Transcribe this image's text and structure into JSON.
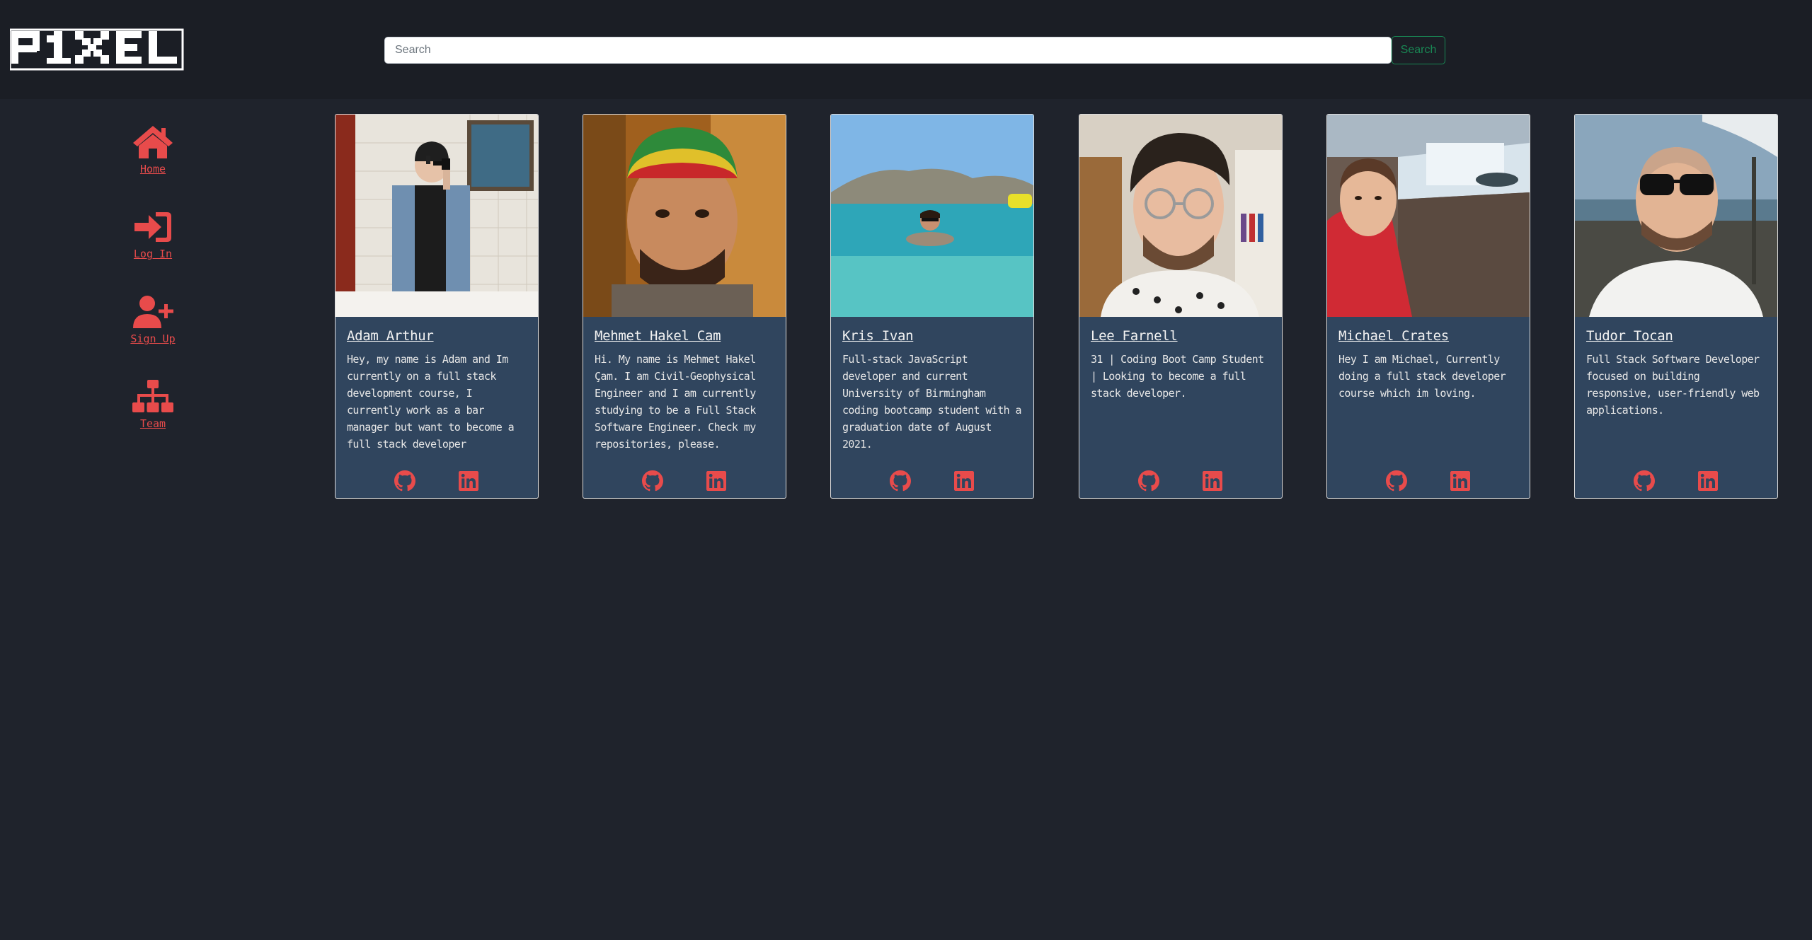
{
  "header": {
    "logo_text": "P1XEL",
    "search": {
      "placeholder": "Search",
      "value": "",
      "button_label": "Search"
    }
  },
  "sidebar": {
    "items": [
      {
        "label": "Home",
        "icon": "home-icon"
      },
      {
        "label": "Log In",
        "icon": "sign-in-icon"
      },
      {
        "label": "Sign Up",
        "icon": "user-plus-icon"
      },
      {
        "label": "Team",
        "icon": "sitemap-icon"
      }
    ]
  },
  "team": [
    {
      "name": "Adam Arthur",
      "bio": "Hey, my name is Adam and Im currently on a full stack development course, I currently work as a bar manager but want to become a full stack developer",
      "photo": "portrait-mirror-selfie"
    },
    {
      "name": "Mehmet Hakel Cam",
      "bio": "Hi. My name is Mehmet Hakel Çam. I am Civil-Geophysical Engineer and I am currently studying to be a Full Stack Software Engineer. Check my repositories, please.",
      "photo": "portrait-rasta-hat"
    },
    {
      "name": "Kris Ivan",
      "bio": "Full-stack JavaScript developer and current University of Birmingham coding bootcamp student with a graduation date of August 2021.",
      "photo": "portrait-swimming-sea"
    },
    {
      "name": "Lee Farnell",
      "bio": "31 | Coding Boot Camp Student | Looking to become a full stack developer.",
      "photo": "portrait-glasses"
    },
    {
      "name": "Michael Crates",
      "bio": "Hey I am Michael, Currently doing a full stack developer course which im loving.",
      "photo": "portrait-waterfall"
    },
    {
      "name": "Tudor Tocan",
      "bio": "Full Stack Software Developer focused on building responsive, user-friendly web applications.",
      "photo": "portrait-sunglasses"
    }
  ],
  "colors": {
    "accent": "#e84b4b",
    "card_bg": "#30455e",
    "page_bg": "#1f232c",
    "header_bg": "#1b1e25",
    "search_button": "#198754"
  }
}
